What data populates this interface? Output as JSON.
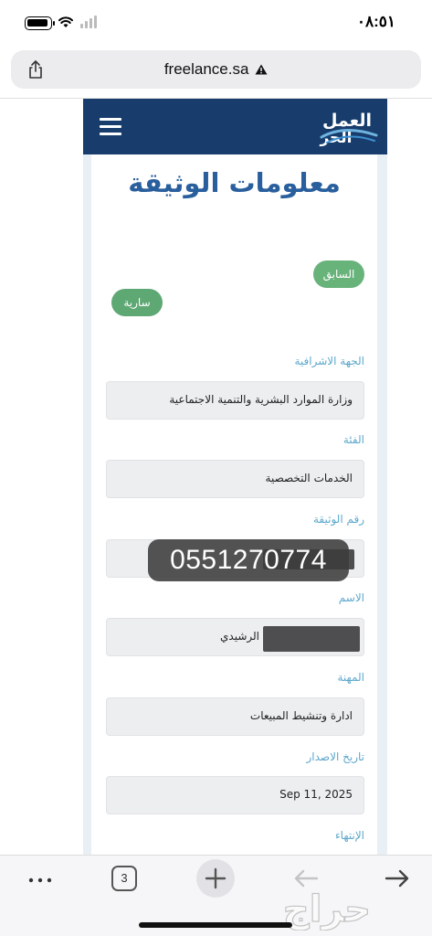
{
  "status_bar": {
    "time": "٠٨:٥١"
  },
  "browser": {
    "url": "freelance.sa",
    "tab_count": "3"
  },
  "site": {
    "logo_text": "العمل الحر"
  },
  "page": {
    "title": "معلومات الوثيقة",
    "prev_button": "السابق",
    "status_badge": "سارية",
    "fields": [
      {
        "label": "الجهة الاشرافية",
        "value": "وزارة الموارد البشرية والتنمية الاجتماعية"
      },
      {
        "label": "الفئة",
        "value": "الخدمات التخصصية"
      },
      {
        "label": "رقم الوثيقة",
        "value": ""
      },
      {
        "label": "الاسم",
        "value": "الرشيدي"
      },
      {
        "label": "المهنة",
        "value": "ادارة وتنشيط المبيعات"
      },
      {
        "label": "تاريخ الاصدار",
        "value": "Sep 11, 2025"
      },
      {
        "label": "الإنتهاء",
        "value": ""
      }
    ],
    "phone_overlay": "0551270774"
  },
  "watermark": "حراج"
}
